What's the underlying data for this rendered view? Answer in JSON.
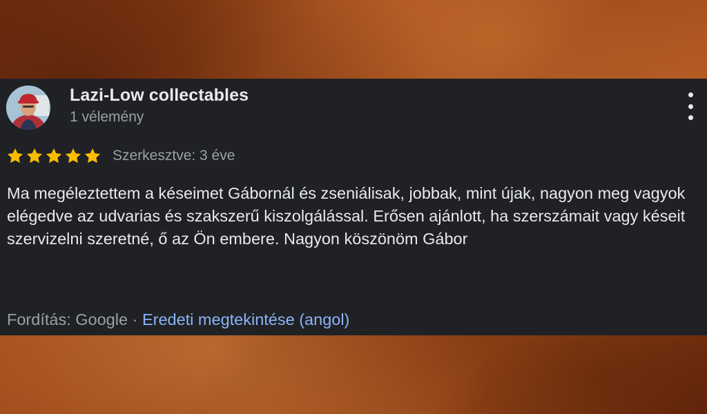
{
  "review": {
    "author_name": "Lazi-Low collectables",
    "review_count": "1 vélemény",
    "rating": 5,
    "rating_max": 5,
    "edited_label": "Szerkesztve: 3 éve",
    "text": "Ma megéleztettem a késeimet Gábornál és zseniálisak, jobbak, mint újak, nagyon meg vagyok elégedve az udvarias és szakszerű kiszolgálással. Erősen ajánlott, ha szerszámait vagy késeit szervizelni szeretné, ő az Ön embere. Nagyon köszönöm Gábor",
    "translation_label": "Fordítás: Google",
    "separator": " · ",
    "original_link": "Eredeti megtekintése (angol)"
  },
  "colors": {
    "card_bg": "#202124",
    "star": "#fbbc04",
    "link": "#8ab4f8",
    "muted": "#9aa0a6"
  },
  "icons": {
    "avatar": "user-avatar-photo",
    "more": "more-vert-icon",
    "star": "star-icon"
  }
}
